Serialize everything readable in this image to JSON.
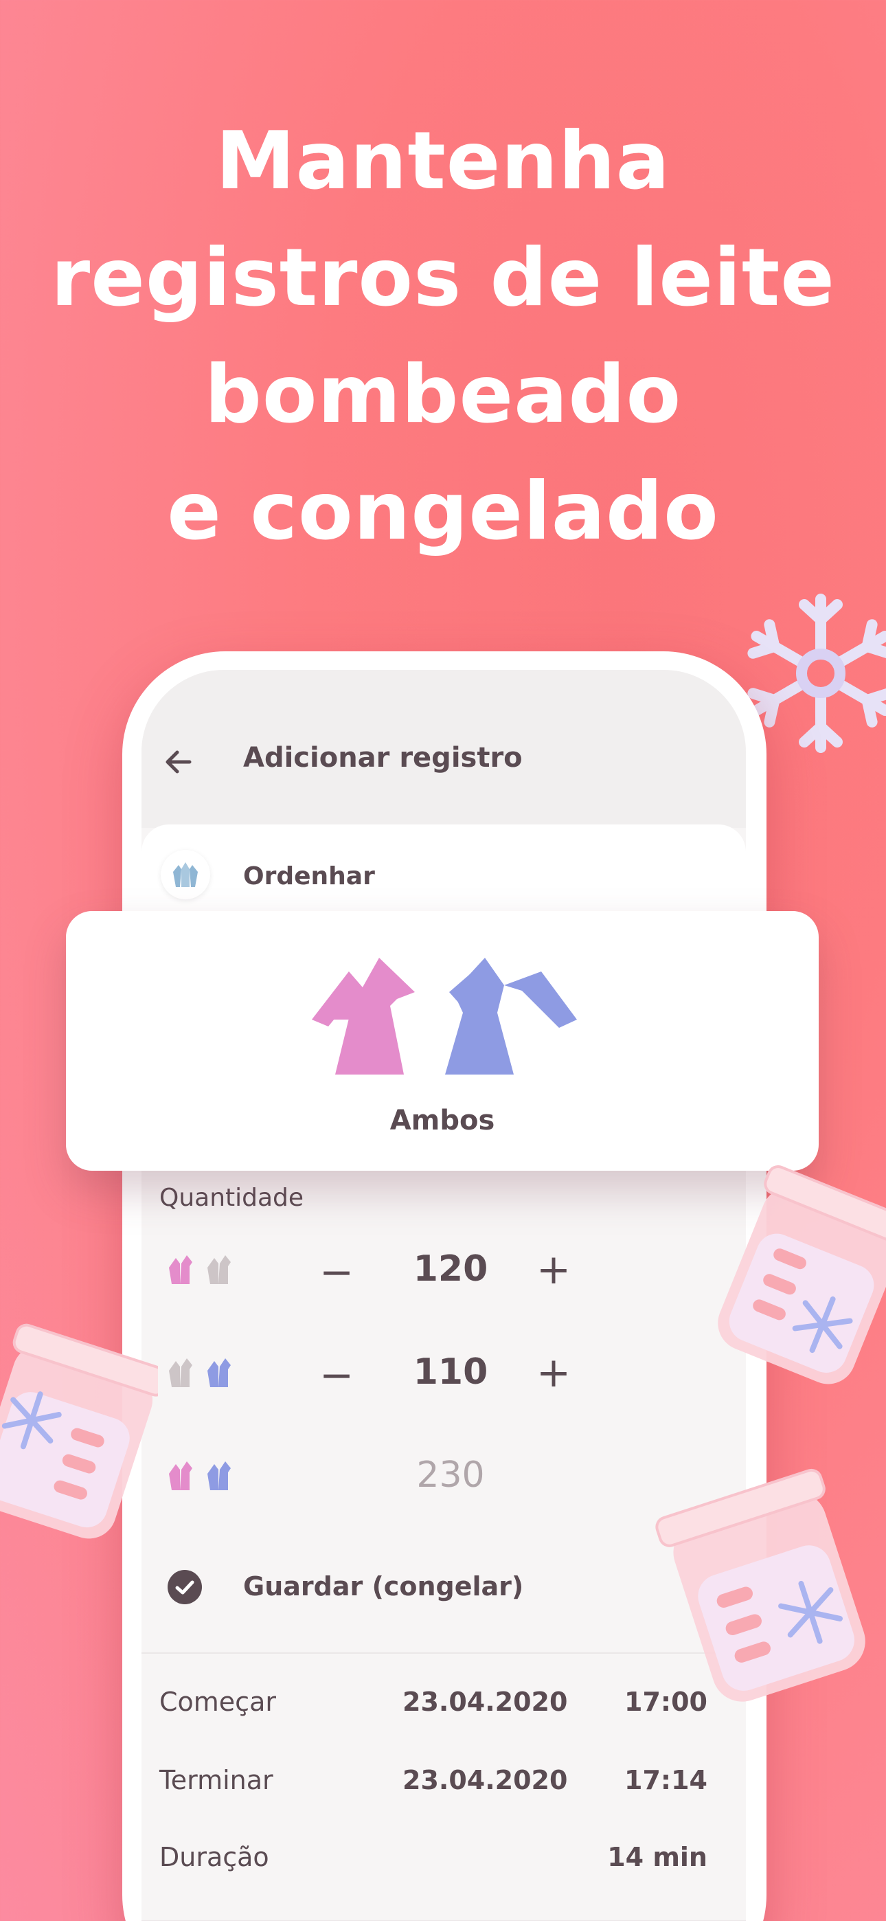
{
  "headline": {
    "line1": "Mantenha",
    "line2": "registros de leite",
    "line3": "bombeado",
    "line4": "e congelado"
  },
  "appbar": {
    "title": "Adicionar registro",
    "back_icon": "arrow-left-icon"
  },
  "mode": {
    "label": "Ordenhar",
    "icon": "breast-pump-icon"
  },
  "selector": {
    "label": "Ambos",
    "icons": [
      "left-breast-pump-icon",
      "right-breast-pump-icon"
    ]
  },
  "quantity": {
    "label": "Quantidade",
    "rows": [
      {
        "side": "left",
        "value": "120",
        "minus": "−",
        "plus": "+"
      },
      {
        "side": "right",
        "value": "110",
        "minus": "−",
        "plus": "+"
      },
      {
        "side": "both",
        "value": "230"
      }
    ]
  },
  "store": {
    "label": "Guardar (congelar)",
    "checked": true
  },
  "times": {
    "start": {
      "label": "Começar",
      "date": "23.04.2020",
      "time": "17:00"
    },
    "end": {
      "label": "Terminar",
      "date": "23.04.2020",
      "time": "17:14"
    },
    "duration": {
      "label": "Duração",
      "value": "14 min"
    }
  },
  "colors": {
    "background": "#fd7b80",
    "left_pump": "#e48ccb",
    "right_pump": "#8e9be3",
    "inactive_pump": "#cdc5c7",
    "text": "#5a4b52"
  }
}
